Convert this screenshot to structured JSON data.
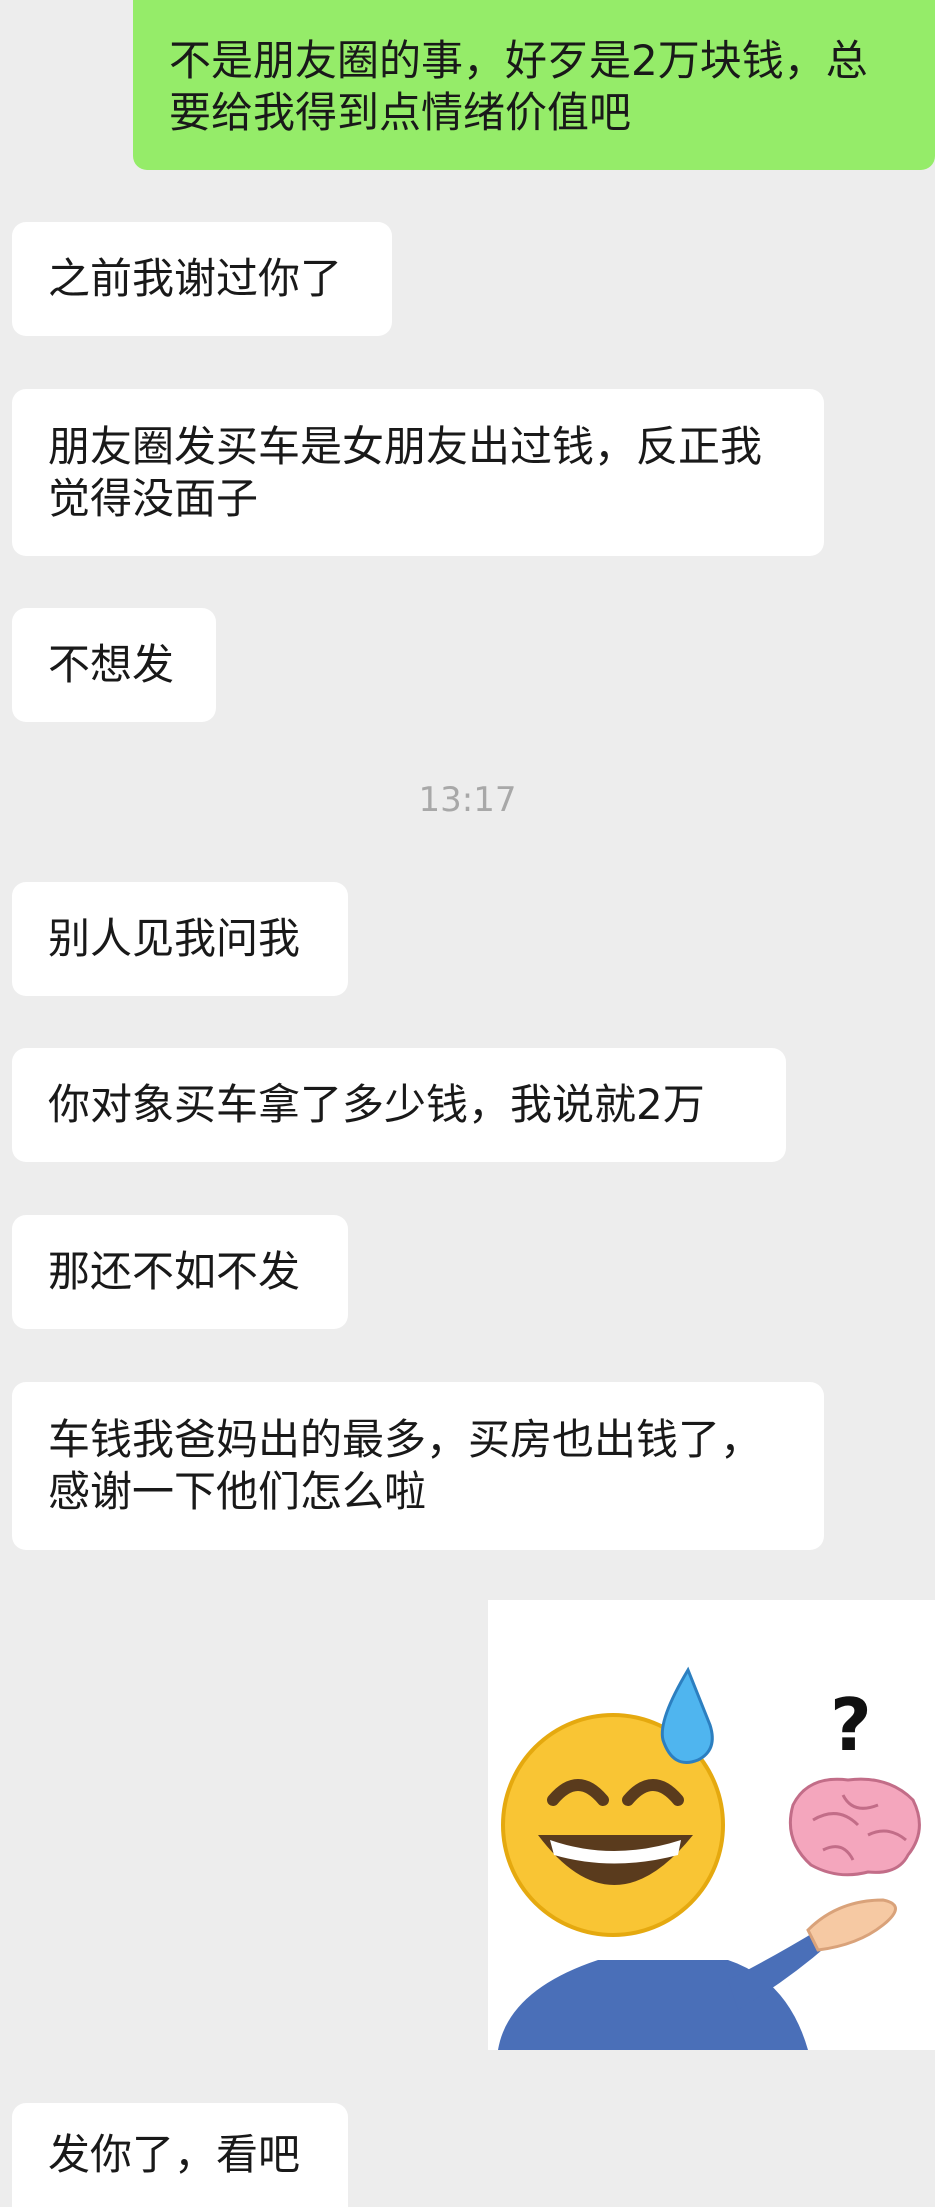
{
  "messages": [
    {
      "side": "right",
      "text": "不是朋友圈的事，好歹是2万块钱，总\n要给我得到点情绪价值吧"
    },
    {
      "side": "left",
      "text": "之前我谢过你了"
    },
    {
      "side": "left",
      "text": "朋友圈发买车是女朋友出过钱，反正我\n觉得没面子"
    },
    {
      "side": "left",
      "text": "不想发"
    },
    {
      "side": "left",
      "text": "别人见我问我"
    },
    {
      "side": "left",
      "text": "你对象买车拿了多少钱，我说就2万"
    },
    {
      "side": "left",
      "text": "那还不如不发"
    },
    {
      "side": "left",
      "text": "车钱我爸妈出的最多，买房也出钱了，\n感谢一下他们怎么啦"
    },
    {
      "side": "left",
      "text": "发你了，看吧"
    }
  ],
  "timestamp": "13:17",
  "sticker": {
    "icon": "sweat-smile-brain-shrug-sticker",
    "question_mark": "?"
  },
  "colors": {
    "background": "#ededed",
    "incoming_bubble": "#ffffff",
    "outgoing_bubble": "#95ec69"
  }
}
